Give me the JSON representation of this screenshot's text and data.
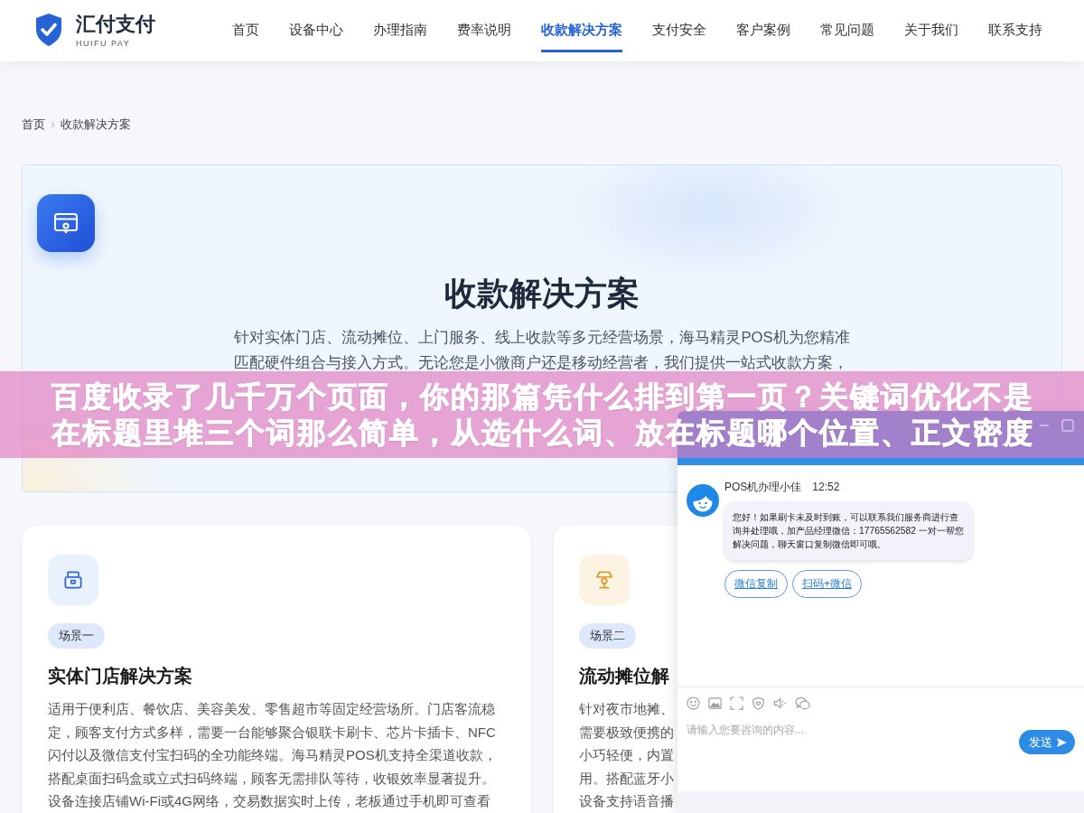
{
  "header": {
    "brand": "汇付支付",
    "brand_subtitle": "HUIFU PAY",
    "nav": [
      {
        "label": "首页",
        "selected": false
      },
      {
        "label": "设备中心",
        "selected": false
      },
      {
        "label": "办理指南",
        "selected": false
      },
      {
        "label": "费率说明",
        "selected": false
      },
      {
        "label": "收款解决方案",
        "selected": true
      },
      {
        "label": "支付安全",
        "selected": false
      },
      {
        "label": "客户案例",
        "selected": false
      },
      {
        "label": "常见问题",
        "selected": false
      },
      {
        "label": "关于我们",
        "selected": false
      },
      {
        "label": "联系支持",
        "selected": false
      }
    ]
  },
  "breadcrumb": [
    "首页",
    "收款解决方案"
  ],
  "hero": {
    "title": "收款解决方案",
    "description_lines": [
      "针对实体门店、流动摊位、上门服务、线上收款等多元经营场景，海马精灵POS机为您精准",
      "匹配硬件组合与接入方式。无论您是小微商户还是移动经营者，我们提供一站式收款方案，"
    ]
  },
  "scenarios": [
    {
      "kind": "store",
      "tag": "场景一",
      "title": "实体门店解决方案",
      "description_lines": [
        "适用于便利店、餐饮店、美容美发、零售超市等固定经营场所。门店客流稳",
        "定，顾客支付方式多样，需要一台能够聚合银联卡刷卡、芯片卡插卡、NFC",
        "闪付以及微信支付宝扫码的全功能终端。海马精灵POS机支持全渠道收款，",
        "搭配桌面扫码盒或立式扫码终端，顾客无需排队等待，收银效率显著提升。",
        "设备连接店铺Wi-Fi或4G网络，交易数据实时上传，老板通过手机即可查看"
      ]
    },
    {
      "kind": "stall",
      "tag": "场景二",
      "title": "流动摊位解",
      "description_lines": [
        "针对夜市地摊、",
        "需要极致便携的",
        "小巧轻便，内置",
        "用。搭配蓝牙小",
        "设备支持语音播"
      ]
    }
  ],
  "overlay_banner": {
    "lines": [
      "百度收录了几千万个页面，你的那篇凭什么排到第一页？关键词优化不是",
      "在标题里堆三个词那么简单，从选什么词、放在标题哪个位置、正文密度"
    ]
  },
  "chat": {
    "agent": "POS机办理小佳",
    "time": "12:52",
    "message": "您好！如果刷卡未及时到账，可以联系我们服务商进行查询并处理哦，加产品经理微信：17765562582 一对一帮您解决问题，聊天窗口复制微信即可哦。",
    "actions": [
      "微信复制",
      "扫码+微信"
    ],
    "input": {
      "placeholder": "请输入您要咨询的内容..."
    },
    "send": "发送"
  }
}
